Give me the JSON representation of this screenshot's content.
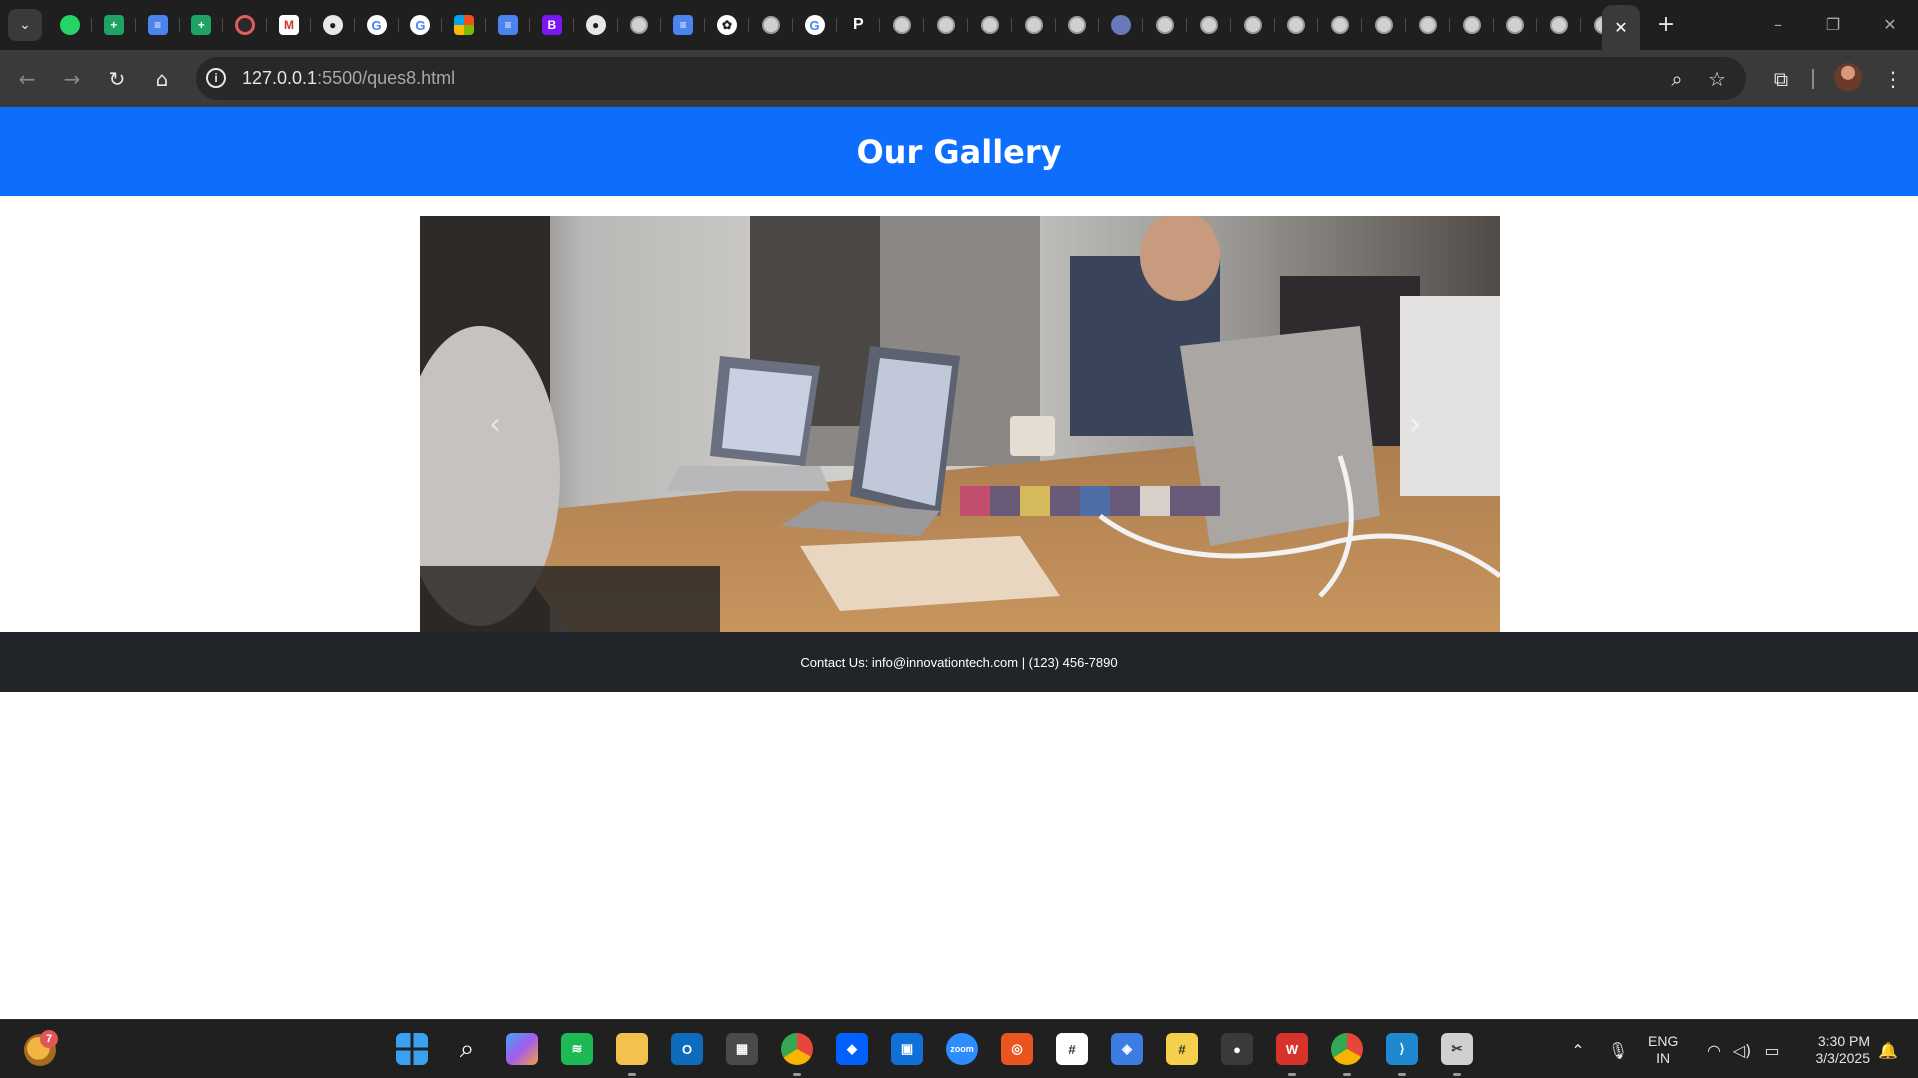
{
  "browser": {
    "url_host": "127.0.0.1",
    "url_path": ":5500/ques8.html",
    "tabs": [
      {
        "icon": "whatsapp-icon",
        "glyph": "",
        "cls": "wa"
      },
      {
        "icon": "google-sheets-icon",
        "glyph": "+",
        "cls": "sheet"
      },
      {
        "icon": "google-docs-icon",
        "glyph": "≡",
        "cls": "doc"
      },
      {
        "icon": "google-sheets-icon",
        "glyph": "+",
        "cls": "sheet"
      },
      {
        "icon": "record-icon",
        "glyph": "",
        "cls": "cam"
      },
      {
        "icon": "gmail-icon",
        "glyph": "M",
        "cls": "gm"
      },
      {
        "icon": "github-icon",
        "glyph": "●",
        "cls": "gh"
      },
      {
        "icon": "google-icon",
        "glyph": "G",
        "cls": "g"
      },
      {
        "icon": "google-icon",
        "glyph": "G",
        "cls": "g"
      },
      {
        "icon": "microsoft-icon",
        "glyph": "",
        "cls": "ms"
      },
      {
        "icon": "google-docs-icon",
        "glyph": "≡",
        "cls": "doc"
      },
      {
        "icon": "bootstrap-icon",
        "glyph": "B",
        "cls": "bs"
      },
      {
        "icon": "github-icon",
        "glyph": "●",
        "cls": "gh"
      },
      {
        "icon": "globe-icon",
        "glyph": "",
        "cls": "globe"
      },
      {
        "icon": "google-docs-icon",
        "glyph": "≡",
        "cls": "doc"
      },
      {
        "icon": "chatgpt-icon",
        "glyph": "✿",
        "cls": "gpt"
      },
      {
        "icon": "globe-icon",
        "glyph": "",
        "cls": "globe"
      },
      {
        "icon": "google-icon",
        "glyph": "G",
        "cls": "g"
      },
      {
        "icon": "perplexity-icon",
        "glyph": "P",
        "cls": "pp"
      },
      {
        "icon": "globe-icon",
        "glyph": "",
        "cls": "globe"
      },
      {
        "icon": "globe-icon",
        "glyph": "",
        "cls": "globe"
      },
      {
        "icon": "globe-icon",
        "glyph": "",
        "cls": "globe"
      },
      {
        "icon": "globe-icon",
        "glyph": "",
        "cls": "globe"
      },
      {
        "icon": "globe-icon",
        "glyph": "",
        "cls": "globe"
      },
      {
        "icon": "avatar-icon",
        "glyph": "",
        "cls": "av"
      },
      {
        "icon": "globe-icon",
        "glyph": "",
        "cls": "globe"
      },
      {
        "icon": "globe-icon",
        "glyph": "",
        "cls": "globe"
      },
      {
        "icon": "globe-icon",
        "glyph": "",
        "cls": "globe"
      },
      {
        "icon": "globe-icon",
        "glyph": "",
        "cls": "globe"
      },
      {
        "icon": "globe-icon",
        "glyph": "",
        "cls": "globe"
      },
      {
        "icon": "globe-icon",
        "glyph": "",
        "cls": "globe"
      },
      {
        "icon": "globe-icon",
        "glyph": "",
        "cls": "globe"
      },
      {
        "icon": "globe-icon",
        "glyph": "",
        "cls": "globe"
      },
      {
        "icon": "globe-icon",
        "glyph": "",
        "cls": "globe"
      },
      {
        "icon": "globe-icon",
        "glyph": "",
        "cls": "globe"
      },
      {
        "icon": "globe-icon",
        "glyph": "",
        "cls": "globe"
      }
    ]
  },
  "page": {
    "title": "Our Gallery",
    "footer": "Contact Us: info@innovationtech.com | (123) 456-7890",
    "carousel_image": "office-meeting-photo"
  },
  "taskbar": {
    "weather_badge": "7",
    "apps": [
      {
        "icon": "windows-start-icon",
        "glyph": "",
        "bg": "#3aa0f0",
        "running": false
      },
      {
        "icon": "search-icon",
        "glyph": "⌕",
        "bg": "transparent",
        "running": false
      },
      {
        "icon": "copilot-icon",
        "glyph": "",
        "bg": "#7b5cf0",
        "running": false
      },
      {
        "icon": "spotify-icon",
        "glyph": "≋",
        "bg": "#1db954",
        "running": false
      },
      {
        "icon": "file-explorer-icon",
        "glyph": "",
        "bg": "#f2c14e",
        "running": true
      },
      {
        "icon": "outlook-icon",
        "glyph": "O",
        "bg": "#0f6cbd",
        "running": false
      },
      {
        "icon": "microsoft-store-icon",
        "glyph": "▦",
        "bg": "#4a4a4a",
        "running": false
      },
      {
        "icon": "chrome-icon",
        "glyph": "",
        "bg": "#e8453c",
        "running": true
      },
      {
        "icon": "dropbox-icon",
        "glyph": "◆",
        "bg": "#0061fe",
        "running": false
      },
      {
        "icon": "app-window-icon",
        "glyph": "▣",
        "bg": "#1070d8",
        "running": false
      },
      {
        "icon": "zoom-icon",
        "glyph": "zoom",
        "bg": "#2d8cff",
        "running": false
      },
      {
        "icon": "ubuntu-icon",
        "glyph": "◎",
        "bg": "#e95420",
        "running": false
      },
      {
        "icon": "slack-icon",
        "glyph": "#",
        "bg": "#ffffff",
        "running": false
      },
      {
        "icon": "synology-icon",
        "glyph": "◈",
        "bg": "#3b7de0",
        "running": false
      },
      {
        "icon": "notes-icon",
        "glyph": "#",
        "bg": "#f5d04c",
        "running": false
      },
      {
        "icon": "screen-recorder-icon",
        "glyph": "●",
        "bg": "#3a3a3a",
        "running": false
      },
      {
        "icon": "wps-office-icon",
        "glyph": "W",
        "bg": "#d8332b",
        "running": true
      },
      {
        "icon": "chrome-profile-icon",
        "glyph": "",
        "bg": "#e8453c",
        "running": true
      },
      {
        "icon": "vscode-icon",
        "glyph": "⟩",
        "bg": "#1e88d0",
        "running": true
      },
      {
        "icon": "snipping-tool-icon",
        "glyph": "✂",
        "bg": "#d0d0d0",
        "running": true
      }
    ],
    "lang_line1": "ENG",
    "lang_line2": "IN",
    "time": "3:30 PM",
    "date": "3/3/2025"
  }
}
